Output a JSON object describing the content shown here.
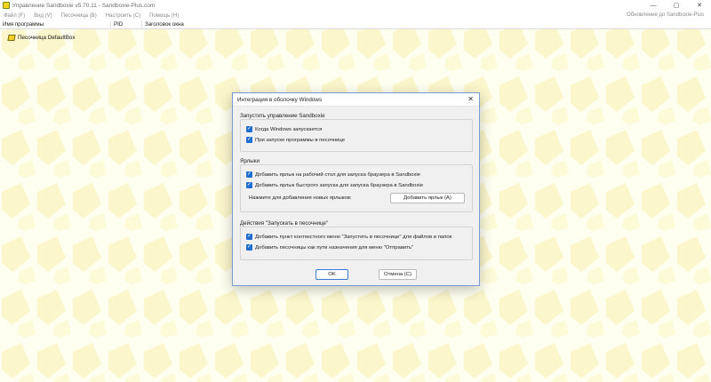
{
  "window": {
    "title": "Управление Sandboxie v5.70.11 - Sandboxie-Plus.com",
    "controls": {
      "minimize": "—",
      "maximize": "▢",
      "close": "✕"
    }
  },
  "menu": {
    "items": [
      "Файл (F)",
      "Вид (V)",
      "Песочница (B)",
      "Настроить (C)",
      "Помощь (H)"
    ],
    "update_link": "Обновление до Sandboxie-Plus"
  },
  "columns": {
    "name": "Имя программы",
    "pid": "PID",
    "title": "Заголовок окна"
  },
  "tree": {
    "sandbox_label": "Песочница DefaultBox"
  },
  "dialog": {
    "title": "Интеграция в оболочку Windows",
    "close_icon": "✕",
    "group_start": {
      "title": "Запустить управление Sandboxie",
      "options": [
        {
          "label": "Когда Windows запускается",
          "checked": true
        },
        {
          "label": "При запуске программы в песочнице",
          "checked": true
        }
      ]
    },
    "group_shortcuts": {
      "title": "Ярлыки",
      "options": [
        {
          "label": "Добавить ярлык на рабочий стол для запуска браузера в Sandboxie",
          "checked": true
        },
        {
          "label": "Добавить ярлык быстрого запуска для запуска браузера в Sandboxie",
          "checked": true
        }
      ],
      "hint": "Нажмите для добавления новых ярлыков:",
      "add_button": "Добавить ярлык (A)"
    },
    "group_actions": {
      "title": "Действия \"Запускать в песочнице\"",
      "options": [
        {
          "label": "Добавить пункт контекстного меню \"Запустить в песочнице\" для файлов и папок",
          "checked": true
        },
        {
          "label": "Добавить песочницы как пути назначения для меню \"Отправить\"",
          "checked": true
        }
      ]
    },
    "ok_button": "OK",
    "cancel_button": "Отмена (C)"
  },
  "colors": {
    "background": "#fffff0",
    "pattern": "#fbf6c8",
    "accent": "#1f6fd0",
    "dialog_border": "#7a9bd2"
  }
}
